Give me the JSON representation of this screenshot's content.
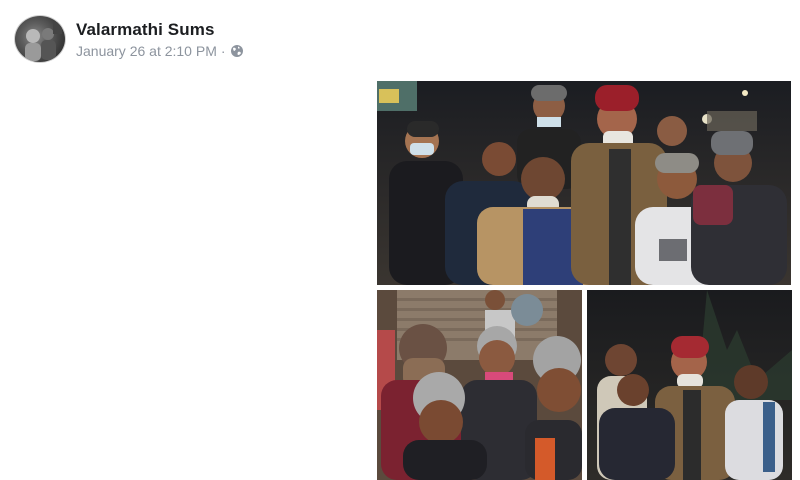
{
  "post": {
    "author": "Valarmathi Sums",
    "timestamp": "January 26 at 2:10 PM",
    "separator": "·",
    "privacy_icon": "globe-icon"
  },
  "photos": [
    {
      "name": "group-photo-night"
    },
    {
      "name": "selfie-photo-beanies"
    },
    {
      "name": "group-photo-street"
    }
  ]
}
